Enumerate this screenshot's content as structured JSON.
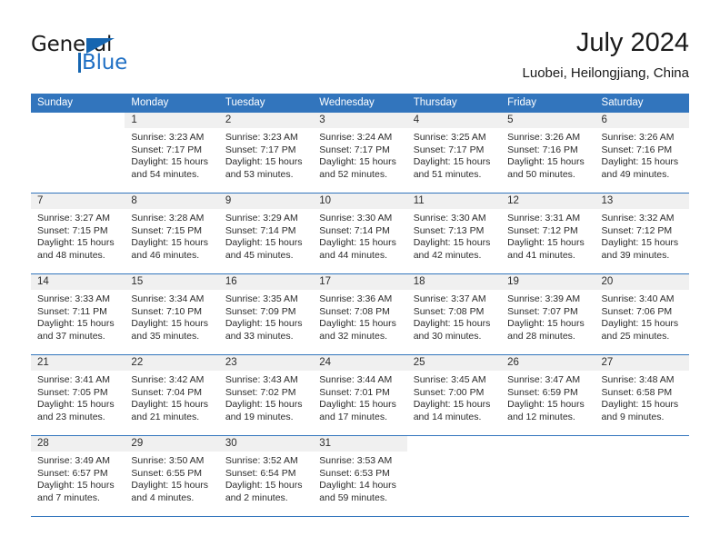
{
  "brand": {
    "word1": "General",
    "word2": "Blue",
    "accent_color": "#1565b0"
  },
  "header": {
    "month_title": "July 2024",
    "location": "Luobei, Heilongjiang, China"
  },
  "calendar": {
    "header_color": "#3275bd",
    "weekdays": [
      "Sunday",
      "Monday",
      "Tuesday",
      "Wednesday",
      "Thursday",
      "Friday",
      "Saturday"
    ],
    "weeks": [
      [
        {
          "day": "",
          "lines": []
        },
        {
          "day": "1",
          "lines": [
            "Sunrise: 3:23 AM",
            "Sunset: 7:17 PM",
            "Daylight: 15 hours",
            "and 54 minutes."
          ]
        },
        {
          "day": "2",
          "lines": [
            "Sunrise: 3:23 AM",
            "Sunset: 7:17 PM",
            "Daylight: 15 hours",
            "and 53 minutes."
          ]
        },
        {
          "day": "3",
          "lines": [
            "Sunrise: 3:24 AM",
            "Sunset: 7:17 PM",
            "Daylight: 15 hours",
            "and 52 minutes."
          ]
        },
        {
          "day": "4",
          "lines": [
            "Sunrise: 3:25 AM",
            "Sunset: 7:17 PM",
            "Daylight: 15 hours",
            "and 51 minutes."
          ]
        },
        {
          "day": "5",
          "lines": [
            "Sunrise: 3:26 AM",
            "Sunset: 7:16 PM",
            "Daylight: 15 hours",
            "and 50 minutes."
          ]
        },
        {
          "day": "6",
          "lines": [
            "Sunrise: 3:26 AM",
            "Sunset: 7:16 PM",
            "Daylight: 15 hours",
            "and 49 minutes."
          ]
        }
      ],
      [
        {
          "day": "7",
          "lines": [
            "Sunrise: 3:27 AM",
            "Sunset: 7:15 PM",
            "Daylight: 15 hours",
            "and 48 minutes."
          ]
        },
        {
          "day": "8",
          "lines": [
            "Sunrise: 3:28 AM",
            "Sunset: 7:15 PM",
            "Daylight: 15 hours",
            "and 46 minutes."
          ]
        },
        {
          "day": "9",
          "lines": [
            "Sunrise: 3:29 AM",
            "Sunset: 7:14 PM",
            "Daylight: 15 hours",
            "and 45 minutes."
          ]
        },
        {
          "day": "10",
          "lines": [
            "Sunrise: 3:30 AM",
            "Sunset: 7:14 PM",
            "Daylight: 15 hours",
            "and 44 minutes."
          ]
        },
        {
          "day": "11",
          "lines": [
            "Sunrise: 3:30 AM",
            "Sunset: 7:13 PM",
            "Daylight: 15 hours",
            "and 42 minutes."
          ]
        },
        {
          "day": "12",
          "lines": [
            "Sunrise: 3:31 AM",
            "Sunset: 7:12 PM",
            "Daylight: 15 hours",
            "and 41 minutes."
          ]
        },
        {
          "day": "13",
          "lines": [
            "Sunrise: 3:32 AM",
            "Sunset: 7:12 PM",
            "Daylight: 15 hours",
            "and 39 minutes."
          ]
        }
      ],
      [
        {
          "day": "14",
          "lines": [
            "Sunrise: 3:33 AM",
            "Sunset: 7:11 PM",
            "Daylight: 15 hours",
            "and 37 minutes."
          ]
        },
        {
          "day": "15",
          "lines": [
            "Sunrise: 3:34 AM",
            "Sunset: 7:10 PM",
            "Daylight: 15 hours",
            "and 35 minutes."
          ]
        },
        {
          "day": "16",
          "lines": [
            "Sunrise: 3:35 AM",
            "Sunset: 7:09 PM",
            "Daylight: 15 hours",
            "and 33 minutes."
          ]
        },
        {
          "day": "17",
          "lines": [
            "Sunrise: 3:36 AM",
            "Sunset: 7:08 PM",
            "Daylight: 15 hours",
            "and 32 minutes."
          ]
        },
        {
          "day": "18",
          "lines": [
            "Sunrise: 3:37 AM",
            "Sunset: 7:08 PM",
            "Daylight: 15 hours",
            "and 30 minutes."
          ]
        },
        {
          "day": "19",
          "lines": [
            "Sunrise: 3:39 AM",
            "Sunset: 7:07 PM",
            "Daylight: 15 hours",
            "and 28 minutes."
          ]
        },
        {
          "day": "20",
          "lines": [
            "Sunrise: 3:40 AM",
            "Sunset: 7:06 PM",
            "Daylight: 15 hours",
            "and 25 minutes."
          ]
        }
      ],
      [
        {
          "day": "21",
          "lines": [
            "Sunrise: 3:41 AM",
            "Sunset: 7:05 PM",
            "Daylight: 15 hours",
            "and 23 minutes."
          ]
        },
        {
          "day": "22",
          "lines": [
            "Sunrise: 3:42 AM",
            "Sunset: 7:04 PM",
            "Daylight: 15 hours",
            "and 21 minutes."
          ]
        },
        {
          "day": "23",
          "lines": [
            "Sunrise: 3:43 AM",
            "Sunset: 7:02 PM",
            "Daylight: 15 hours",
            "and 19 minutes."
          ]
        },
        {
          "day": "24",
          "lines": [
            "Sunrise: 3:44 AM",
            "Sunset: 7:01 PM",
            "Daylight: 15 hours",
            "and 17 minutes."
          ]
        },
        {
          "day": "25",
          "lines": [
            "Sunrise: 3:45 AM",
            "Sunset: 7:00 PM",
            "Daylight: 15 hours",
            "and 14 minutes."
          ]
        },
        {
          "day": "26",
          "lines": [
            "Sunrise: 3:47 AM",
            "Sunset: 6:59 PM",
            "Daylight: 15 hours",
            "and 12 minutes."
          ]
        },
        {
          "day": "27",
          "lines": [
            "Sunrise: 3:48 AM",
            "Sunset: 6:58 PM",
            "Daylight: 15 hours",
            "and 9 minutes."
          ]
        }
      ],
      [
        {
          "day": "28",
          "lines": [
            "Sunrise: 3:49 AM",
            "Sunset: 6:57 PM",
            "Daylight: 15 hours",
            "and 7 minutes."
          ]
        },
        {
          "day": "29",
          "lines": [
            "Sunrise: 3:50 AM",
            "Sunset: 6:55 PM",
            "Daylight: 15 hours",
            "and 4 minutes."
          ]
        },
        {
          "day": "30",
          "lines": [
            "Sunrise: 3:52 AM",
            "Sunset: 6:54 PM",
            "Daylight: 15 hours",
            "and 2 minutes."
          ]
        },
        {
          "day": "31",
          "lines": [
            "Sunrise: 3:53 AM",
            "Sunset: 6:53 PM",
            "Daylight: 14 hours",
            "and 59 minutes."
          ]
        },
        {
          "day": "",
          "lines": []
        },
        {
          "day": "",
          "lines": []
        },
        {
          "day": "",
          "lines": []
        }
      ]
    ]
  }
}
